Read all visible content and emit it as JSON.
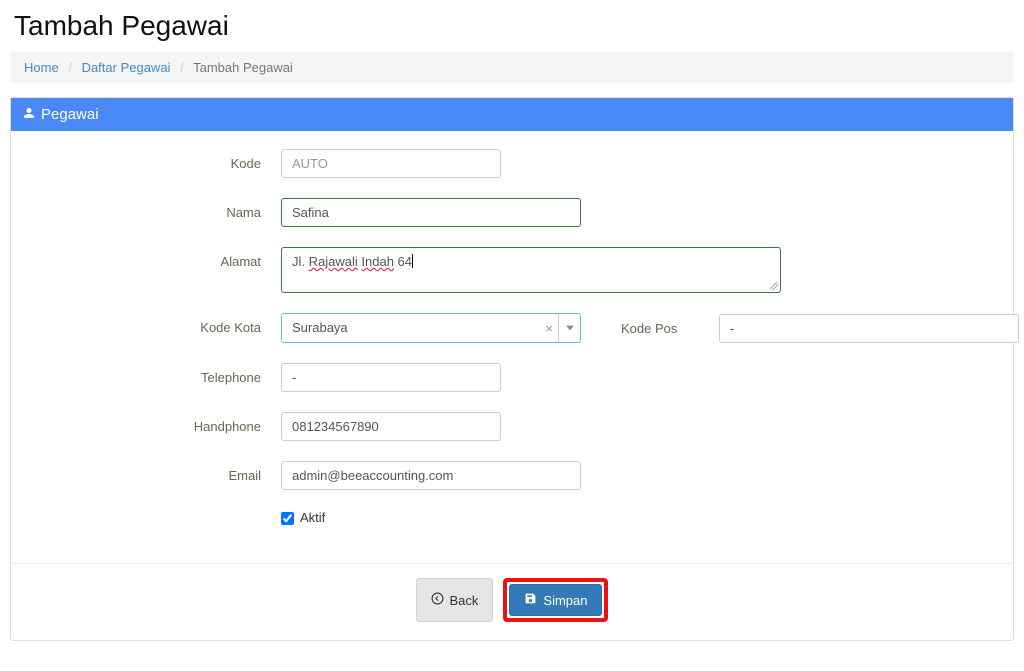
{
  "page_title": "Tambah Pegawai",
  "breadcrumb": {
    "home": "Home",
    "list": "Daftar Pegawai",
    "current": "Tambah Pegawai"
  },
  "panel": {
    "title": "Pegawai"
  },
  "labels": {
    "kode": "Kode",
    "nama": "Nama",
    "alamat": "Alamat",
    "kode_kota": "Kode Kota",
    "kode_pos": "Kode Pos",
    "telephone": "Telephone",
    "handphone": "Handphone",
    "email": "Email",
    "aktif": "Aktif"
  },
  "values": {
    "kode": "AUTO",
    "nama": "Safina",
    "alamat_prefix": "Jl. ",
    "alamat_red1": "Rajawali",
    "alamat_sep": " ",
    "alamat_red2": "Indah",
    "alamat_suffix": " 64",
    "kode_kota": "Surabaya",
    "kode_pos": "-",
    "telephone": "-",
    "handphone": "081234567890",
    "email": "admin@beeaccounting.com",
    "aktif_checked": true
  },
  "buttons": {
    "back": "Back",
    "simpan": "Simpan"
  }
}
